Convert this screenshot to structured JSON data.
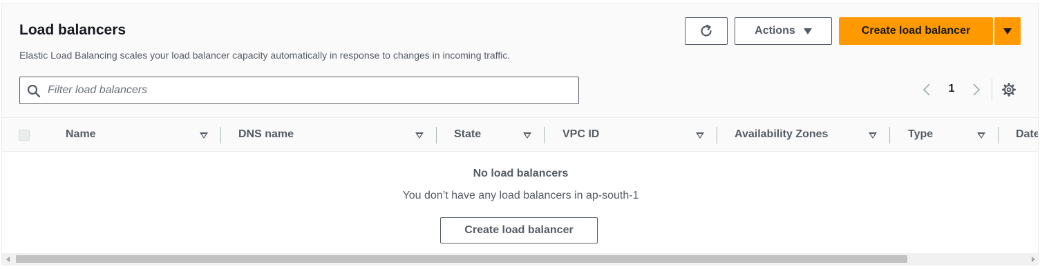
{
  "header": {
    "title": "Load balancers",
    "description": "Elastic Load Balancing scales your load balancer capacity automatically in response to changes in incoming traffic."
  },
  "toolbar": {
    "refresh_icon": "refresh-icon",
    "actions_label": "Actions",
    "create_label": "Create load balancer",
    "accent_color": "#ff9900"
  },
  "filter": {
    "placeholder": "Filter load balancers",
    "value": ""
  },
  "pagination": {
    "current_page": "1"
  },
  "table": {
    "columns": [
      {
        "label": "Name"
      },
      {
        "label": "DNS name"
      },
      {
        "label": "State"
      },
      {
        "label": "VPC ID"
      },
      {
        "label": "Availability Zones"
      },
      {
        "label": "Type"
      },
      {
        "label": "Date created"
      }
    ]
  },
  "empty_state": {
    "title": "No load balancers",
    "message": "You don’t have any load balancers in ap-south-1",
    "button_label": "Create load balancer"
  }
}
